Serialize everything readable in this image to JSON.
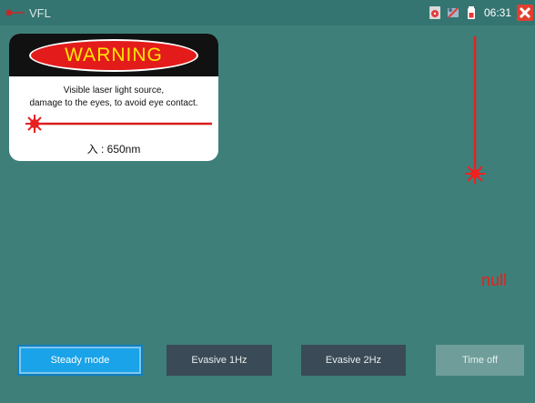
{
  "header": {
    "app_title": "VFL",
    "time": "06:31"
  },
  "icons": {
    "app": "laser-icon",
    "status": [
      "disc-icon",
      "tools-icon",
      "battery-icon",
      "close-icon"
    ]
  },
  "warning": {
    "title": "WARNING",
    "line1": "Visible laser light source,",
    "line2": "damage to the eyes, to avoid eye contact.",
    "wavelength": "入 : 650nm"
  },
  "status_value": "null",
  "modes": {
    "steady": "Steady mode",
    "hz1": "Evasive 1Hz",
    "hz2": "Evasive 2Hz",
    "off": "Time off"
  },
  "colors": {
    "background": "#3e7f7a",
    "laser_red": "#e8201c",
    "active_button": "#1aa3e8",
    "button": "#3a4a57"
  }
}
